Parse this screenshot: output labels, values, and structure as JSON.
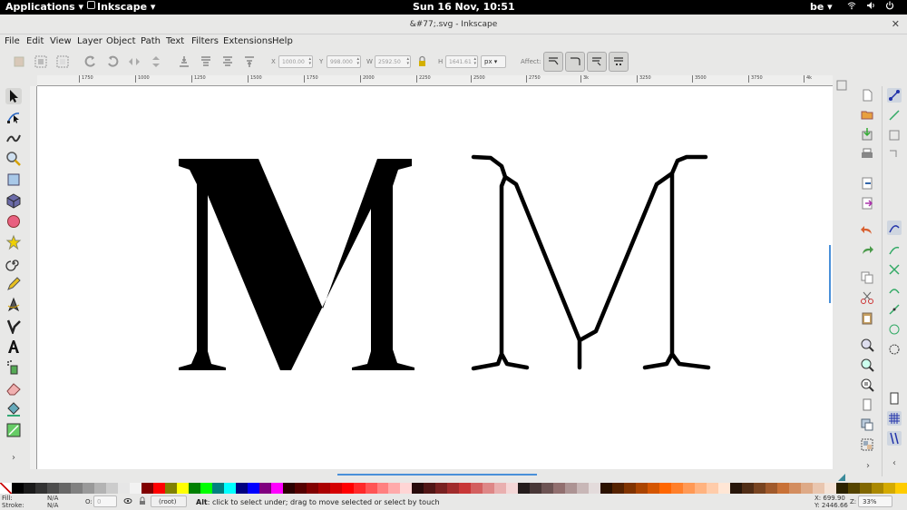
{
  "system_bar": {
    "apps_menu": "Applications ▾",
    "app_name": "Inkscape ▾",
    "datetime": "Sun 16 Nov, 10:51",
    "keyboard_layout": "be ▾"
  },
  "window": {
    "title": "&#77;.svg - Inkscape"
  },
  "menu": [
    "File",
    "Edit",
    "View",
    "Layer",
    "Object",
    "Path",
    "Text",
    "Filters",
    "Extensions",
    "Help"
  ],
  "toolbar": {
    "x_label": "X",
    "x_value": "1000.00",
    "y_label": "Y",
    "y_value": "998.000",
    "w_label": "W",
    "w_value": "2592.50",
    "h_label": "H",
    "h_value": "1641.61",
    "unit": "px ▾",
    "affect_label": "Affect:"
  },
  "ruler": {
    "ticks": [
      "1750",
      "1000",
      "1250",
      "1500",
      "1750",
      "2000",
      "2250",
      "2500",
      "2750",
      "3k",
      "3250",
      "3500",
      "3750",
      "4k"
    ]
  },
  "tools": [
    "selector-tool",
    "node-tool",
    "tweak-tool",
    "zoom-tool",
    "rectangle-tool",
    "3d-box-tool",
    "ellipse-tool",
    "star-tool",
    "spiral-tool",
    "pencil-tool",
    "pen-tool",
    "calligraphy-tool",
    "text-tool",
    "spray-tool",
    "eraser-tool",
    "paint-bucket-tool",
    "gradient-tool"
  ],
  "statusbar": {
    "fill_label": "Fill:",
    "fill_value": "N/A",
    "stroke_label": "Stroke:",
    "stroke_value": "N/A",
    "opacity_label": "O:",
    "opacity_value": "0",
    "layer": "(root)",
    "hint_key": "Alt",
    "hint_text": ": click to select under; drag to move selected or select by touch",
    "x_coord": "X:  699.90",
    "y_coord": "Y: 2446.66",
    "zoom_label": "Z:",
    "zoom_value": "33%"
  },
  "palette": [
    "#ffffff",
    "#000000",
    "#1a1a1a",
    "#333333",
    "#4d4d4d",
    "#666666",
    "#808080",
    "#999999",
    "#b3b3b3",
    "#cccccc",
    "#e6e6e6",
    "#f2f2f2",
    "#800000",
    "#ff0000",
    "#808000",
    "#ffff00",
    "#008000",
    "#00ff00",
    "#008080",
    "#00ffff",
    "#000080",
    "#0000ff",
    "#800080",
    "#ff00ff",
    "#2b0000",
    "#550000",
    "#800000",
    "#aa0000",
    "#d40000",
    "#ff0000",
    "#ff2a2a",
    "#ff5555",
    "#ff8080",
    "#ffaaaa",
    "#ffd5d5",
    "#280b0b",
    "#501616",
    "#782121",
    "#a02c2c",
    "#c83737",
    "#d35f5f",
    "#de8787",
    "#e9afaf",
    "#f4d7d7",
    "#241c1c",
    "#483737",
    "#6c5353",
    "#916f6f",
    "#ac9393",
    "#c8b7b7",
    "#e3dbdb",
    "#2b1100",
    "#552200",
    "#803300",
    "#aa4400",
    "#d45500",
    "#ff6600",
    "#ff7f2a",
    "#ff9955",
    "#ffb380",
    "#ffccaa",
    "#ffe6d5",
    "#28170b",
    "#502d16",
    "#784421",
    "#a05a2c",
    "#c87137",
    "#d38d5f",
    "#deaa87",
    "#e9c6af",
    "#f4e3d7",
    "#2b2200",
    "#554400",
    "#806600",
    "#aa8800",
    "#d4aa00",
    "#ffcc00"
  ]
}
